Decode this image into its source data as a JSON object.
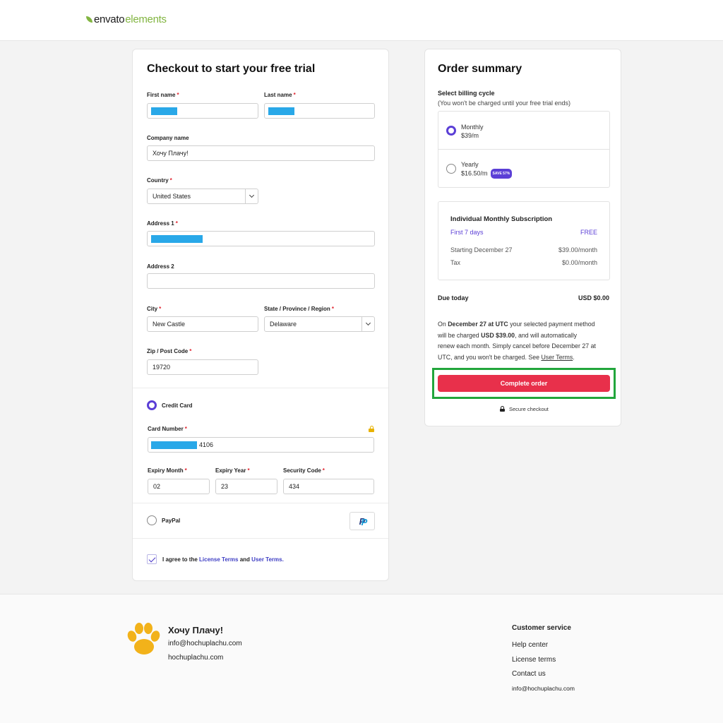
{
  "header": {
    "logo_part1": "envato",
    "logo_part2": "elements"
  },
  "checkout": {
    "title": "Checkout to start your free trial",
    "first_name_label": "First name",
    "last_name_label": "Last name",
    "company_label": "Company name",
    "company_value": "Хочу Плачу!",
    "country_label": "Country",
    "country_value": "United States",
    "address1_label": "Address 1",
    "address2_label": "Address 2",
    "city_label": "City",
    "city_value": "New Castle",
    "state_label": "State / Province / Region",
    "state_value": "Delaware",
    "zip_label": "Zip / Post Code",
    "zip_value": "19720",
    "credit_card_label": "Credit Card",
    "card_number_label": "Card Number",
    "card_number_suffix": "4106",
    "expiry_month_label": "Expiry Month",
    "expiry_month_value": "02",
    "expiry_year_label": "Expiry Year",
    "expiry_year_value": "23",
    "security_code_label": "Security Code",
    "security_code_value": "434",
    "paypal_label": "PayPal",
    "paypal_logo": "P",
    "agree_prefix": "I agree to the",
    "license_terms": "License Terms",
    "agree_and": "and",
    "user_terms": "User Terms."
  },
  "summary": {
    "title": "Order summary",
    "billing_label": "Select billing cycle",
    "billing_note": "(You won't be charged until your free trial ends)",
    "monthly_label": "Monthly",
    "monthly_price": "$39/m",
    "yearly_label": "Yearly",
    "yearly_price": "$16.50/m",
    "save_badge": "SAVE 57%",
    "subscription_title": "Individual Monthly Subscription",
    "first_days_label": "First 7 days",
    "first_days_value": "FREE",
    "starting_label": "Starting December 27",
    "starting_value": "$39.00/month",
    "tax_label": "Tax",
    "tax_value": "$0.00/month",
    "due_label": "Due today",
    "due_value": "USD $0.00",
    "notice_1": "On",
    "notice_date": "December 27 at UTC",
    "notice_2": "your selected payment method",
    "notice_3": "will be charged",
    "notice_amount": "USD $39.00",
    "notice_4": ", and will automatically",
    "notice_5": "renew each month. Simply cancel before December 27 at",
    "notice_6": "UTC, and you won't be charged. See",
    "notice_terms": "User Terms",
    "notice_end": ".",
    "complete_button": "Complete order",
    "secure_text": "Secure checkout"
  },
  "footer": {
    "company": "Хочу Плачу!",
    "email": "info@hochuplachu.com",
    "website": "hochuplachu.com",
    "cs_title": "Customer service",
    "links": [
      "Help center",
      "License terms",
      "Contact us",
      "info@hochuplachu.com"
    ]
  },
  "colors": {
    "accent": "#5b3fd6",
    "cta": "#e8304b",
    "highlight": "#22a63c",
    "brand_green": "#82b541"
  },
  "icons": [
    "envato-leaf-icon",
    "chevron-down-icon",
    "lock-icon",
    "paypal-icon",
    "checkmark-icon",
    "paw-icon"
  ]
}
